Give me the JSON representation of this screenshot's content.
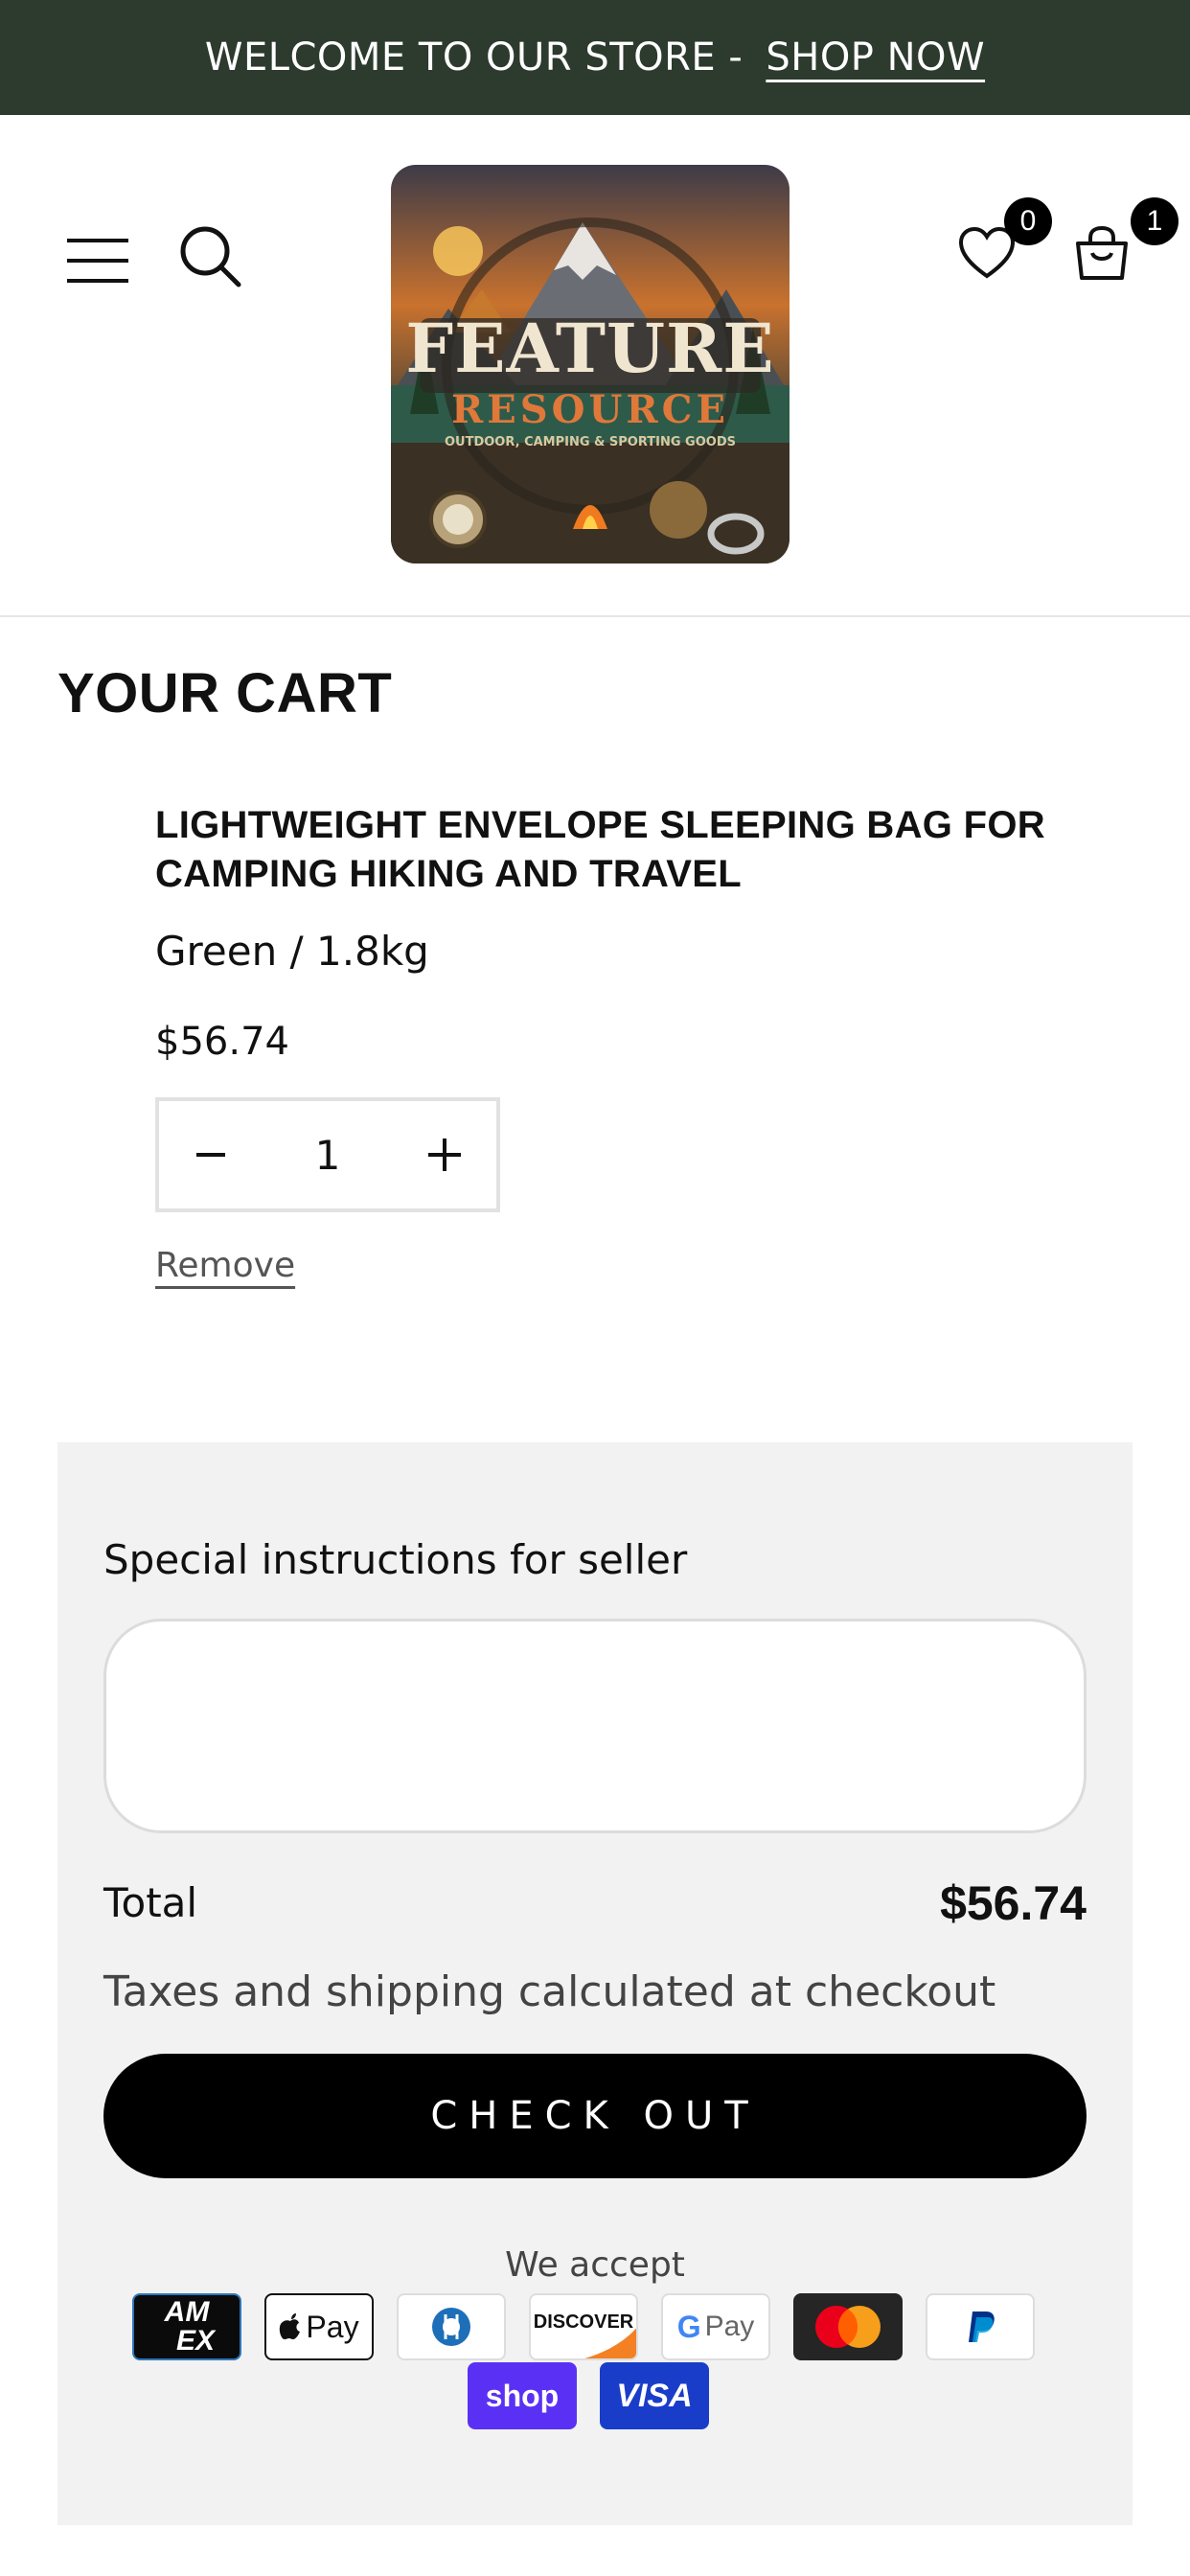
{
  "announcement": {
    "text": "WELCOME TO OUR STORE -",
    "link": "SHOP NOW"
  },
  "header": {
    "logo": {
      "line1": "FEATURE",
      "line2": "RESOURCE",
      "tagline": "OUTDOOR, CAMPING & SPORTING GOODS"
    },
    "wishlist_count": "0",
    "cart_count": "1"
  },
  "cart": {
    "title": "YOUR CART",
    "item": {
      "title": "LIGHTWEIGHT ENVELOPE SLEEPING BAG FOR CAMPING HIKING AND TRAVEL",
      "variant": "Green / 1.8kg",
      "price": "$56.74",
      "quantity": "1",
      "remove_label": "Remove"
    }
  },
  "summary": {
    "instructions_label": "Special instructions for seller",
    "instructions_value": "",
    "total_label": "Total",
    "total_value": "$56.74",
    "tax_note": "Taxes and shipping calculated at checkout",
    "checkout_label": "CHECK OUT",
    "accept_label": "We accept"
  },
  "payments": {
    "amex": {
      "line1": "AM",
      "line2": "EX"
    },
    "applepay": "Pay",
    "discover": "DISCOVER",
    "gpay": "Pay",
    "shop": "shop",
    "visa": "VISA"
  },
  "colors": {
    "announcement_bg": "#2d3a2e",
    "panel_bg": "#f2f2f2",
    "checkout_bg": "#000000"
  }
}
